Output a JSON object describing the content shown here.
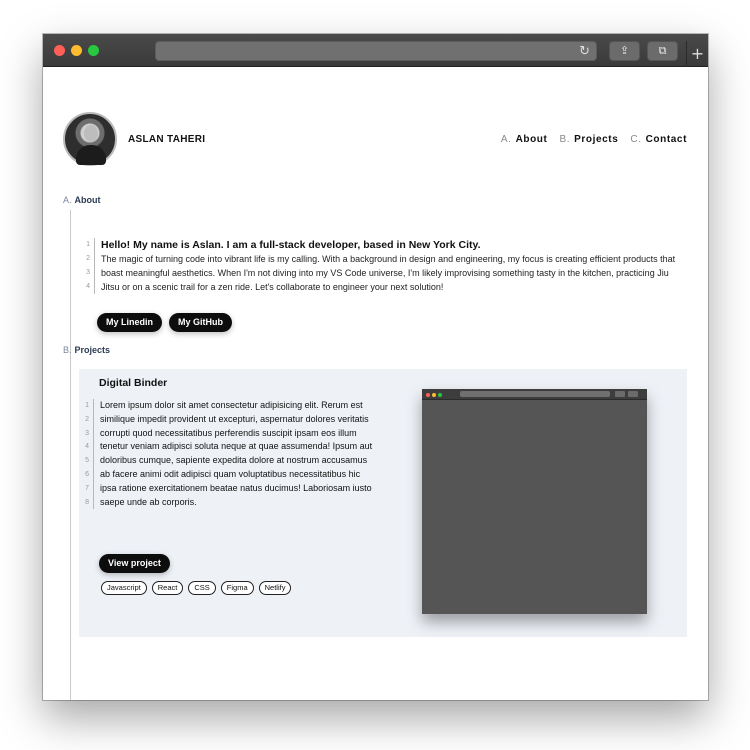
{
  "browser": {
    "reload_icon": "reload-icon",
    "share_icon": "share-icon",
    "tabs_icon": "tabs-icon",
    "new_tab_icon": "plus-icon"
  },
  "header": {
    "name": "ASLAN TAHERI",
    "nav": [
      {
        "letter": "A.",
        "label": "About"
      },
      {
        "letter": "B.",
        "label": "Projects"
      },
      {
        "letter": "C.",
        "label": "Contact"
      }
    ]
  },
  "about": {
    "section_letter": "A.",
    "section_label": "About",
    "line_numbers": [
      "1",
      "2",
      "3",
      "4"
    ],
    "headline": "Hello! My name is Aslan. I am a full-stack developer, based in New York City.",
    "line2": "The magic of turning code into vibrant life is my calling. With a background in design and engineering, my focus is creating efficient products that",
    "line3": "boast meaningful aesthetics. When I'm not diving into my VS Code universe, I'm likely improvising something tasty in the kitchen, practicing Jiu",
    "line4": "Jitsu or on a scenic trail for a zen ride. Let's collaborate to engineer your next solution!",
    "buttons": {
      "linkedin": "My Linedin",
      "github": "My GitHub"
    }
  },
  "projects": {
    "section_letter": "B.",
    "section_label": "Projects",
    "items": [
      {
        "title": "Digital Binder",
        "lines": [
          {
            "n": "1",
            "text": "Lorem ipsum dolor sit amet consectetur adipisicing elit. Rerum est"
          },
          {
            "n": "2",
            "text": "similique impedit provident ut excepturi, aspernatur dolores veritatis"
          },
          {
            "n": "3",
            "text": "corrupti quod necessitatibus perferendis suscipit ipsam eos illum"
          },
          {
            "n": "4",
            "text": "tenetur veniam adipisci soluta neque at quae assumenda! Ipsum aut"
          },
          {
            "n": "5",
            "text": "doloribus cumque, sapiente expedita dolore at nostrum accusamus"
          },
          {
            "n": "6",
            "text": "ab facere animi odit adipisci quam voluptatibus necessitatibus hic"
          },
          {
            "n": "7",
            "text": "ipsa ratione exercitationem beatae natus ducimus! Laboriosam iusto"
          },
          {
            "n": "8",
            "text": "saepe unde ab corporis."
          }
        ],
        "button": "View project",
        "tags": [
          "Javascript",
          "React",
          "CSS",
          "Figma",
          "Netlify"
        ]
      }
    ]
  }
}
